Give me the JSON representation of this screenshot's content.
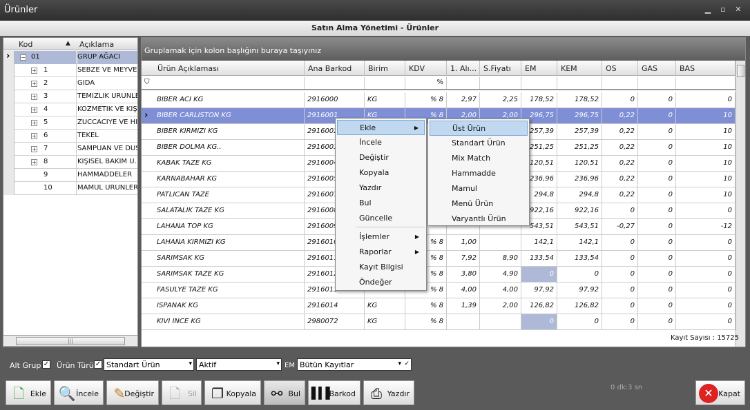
{
  "window": {
    "title": "Ürünler",
    "subtitle": "Satın Alma Yönetimi - Ürünler"
  },
  "tree": {
    "headers": {
      "kod": "Kod",
      "aciklama": "Açıklama"
    },
    "rows": [
      {
        "kod": "01",
        "label": "GRUP AĞACI"
      },
      {
        "kod": "1",
        "label": "SEBZE VE MEYVEL"
      },
      {
        "kod": "2",
        "label": "GIDA"
      },
      {
        "kod": "3",
        "label": "TEMİZLİK ÜRÜNLE"
      },
      {
        "kod": "4",
        "label": "KOZMETİK VE KİŞ"
      },
      {
        "kod": "5",
        "label": "ZÜCCACİYE VE Hİ"
      },
      {
        "kod": "6",
        "label": "TEKEL"
      },
      {
        "kod": "7",
        "label": "SAMPUAN VE DUS"
      },
      {
        "kod": "8",
        "label": "KİŞİSEL BAKIM Ü."
      },
      {
        "kod": "9",
        "label": "HAMMADDELER"
      },
      {
        "kod": "10",
        "label": "MAMÜL ÜRÜNLER"
      }
    ]
  },
  "grid": {
    "group_hint": "Gruplamak için kolon başlığını buraya taşıyınız",
    "columns": [
      "Ürün Açıklaması",
      "Ana Barkod",
      "Birim",
      "KDV",
      "1. Alı...",
      "S.Fiyatı",
      "EM",
      "KEM",
      "OS",
      "GAS",
      "BAS"
    ],
    "filter": {
      "kdv": "%"
    },
    "rows": [
      [
        "BIBER ACI KG",
        "2916000",
        "KG",
        "% 8",
        "2,97",
        "2,25",
        "178,52",
        "178,52",
        "0",
        "0",
        "0"
      ],
      [
        "BIBER CARLISTON KG",
        "2916001",
        "KG",
        "% 8",
        "2,00",
        "2,00",
        "296,75",
        "296,75",
        "0,22",
        "0",
        "10"
      ],
      [
        "BIBER KIRMIZI KG",
        "2916002",
        "",
        "",
        "",
        "",
        "257,39",
        "257,39",
        "0,22",
        "0",
        "10"
      ],
      [
        "BIBER DOLMA KG..",
        "2916003",
        "",
        "",
        "",
        "",
        "251,25",
        "251,25",
        "0,22",
        "0",
        "10"
      ],
      [
        "KABAK TAZE KG",
        "2916004",
        "",
        "",
        "",
        "",
        "120,51",
        "120,51",
        "0,22",
        "0",
        "10"
      ],
      [
        "KARNABAHAR KG",
        "2916005",
        "",
        "",
        "",
        "",
        "236,96",
        "236,96",
        "0,22",
        "0",
        "10"
      ],
      [
        "PATLICAN TAZE",
        "2916007",
        "",
        "",
        "",
        "",
        "294,8",
        "294,8",
        "0,22",
        "0",
        "10"
      ],
      [
        "SALATALIK TAZE KG",
        "2916008",
        "",
        "",
        "",
        "",
        "922,16",
        "922,16",
        "0",
        "0",
        "0"
      ],
      [
        "LAHANA TOP KG",
        "2916009",
        "",
        "",
        "",
        "",
        "543,51",
        "543,51",
        "-0,27",
        "0",
        "-12"
      ],
      [
        "LAHANA KIRMIZI KG",
        "2916010",
        "",
        "% 8",
        "1,00",
        "",
        "142,1",
        "142,1",
        "0",
        "0",
        "0"
      ],
      [
        "SARIMSAK KG",
        "2916011",
        "",
        "% 8",
        "7,92",
        "8,90",
        "133,54",
        "133,54",
        "0",
        "0",
        "0"
      ],
      [
        "SARIMSAK TAZE KG",
        "2916012",
        "",
        "% 8",
        "3,80",
        "4,90",
        "0",
        "0",
        "0",
        "0",
        "0"
      ],
      [
        "FASULYE TAZE KG",
        "2916013",
        "",
        "% 8",
        "4,00",
        "4,00",
        "97,92",
        "97,92",
        "0",
        "0",
        "0"
      ],
      [
        "ISPANAK  KG",
        "2916014",
        "KG",
        "% 8",
        "1,39",
        "2,00",
        "126,82",
        "126,82",
        "0",
        "0",
        "0"
      ],
      [
        "KIVI INCE KG",
        "2980072",
        "KG",
        "% 8",
        "",
        "",
        "0",
        "0",
        "0",
        "0",
        "0"
      ]
    ],
    "record_count": "Kayıt Sayısı : 15725"
  },
  "context_menu": {
    "items": [
      "Ekle",
      "İncele",
      "Değiştir",
      "Kopyala",
      "Yazdır",
      "Bul",
      "Güncelle",
      "İşlemler",
      "Raporlar",
      "Kayıt Bilgisi",
      "Öndeğer"
    ],
    "submenu": [
      "Üst Ürün",
      "Standart Ürün",
      "Mix Match",
      "Hammadde",
      "Mamul",
      "Menü Ürün",
      "Varyantlı Ürün"
    ]
  },
  "filters": {
    "alt_grup": "Alt Grup",
    "urun_turu": "Ürün Türü",
    "urun_turu_value": "Standart Ürün",
    "status_value": "Aktif",
    "em_label": "EM",
    "records_value": "Bütün Kayıtlar",
    "check": "✓"
  },
  "toolbar": {
    "ekle": "Ekle",
    "incele": "İncele",
    "degistir": "Değiştir",
    "sil": "Sil",
    "kopyala": "Kopyala",
    "bul": "Bul",
    "barkod": "Barkod",
    "yazdir": "Yazdır",
    "kapat": "Kapat",
    "timer": "0 dk:3 sn"
  }
}
